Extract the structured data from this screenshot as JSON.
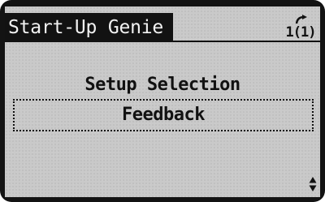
{
  "header": {
    "title": "Start-Up Genie",
    "menu_indicator": "1(1)",
    "menu_icon": "back-arrow-icon"
  },
  "main": {
    "label": "Setup Selection",
    "selected_value": "Feedback"
  },
  "footer": {
    "scroll_icon": "up-down-arrow-icon"
  },
  "colors": {
    "lcd_background": "#c9c9c9",
    "lcd_text": "#111111",
    "bezel": "#131313"
  }
}
